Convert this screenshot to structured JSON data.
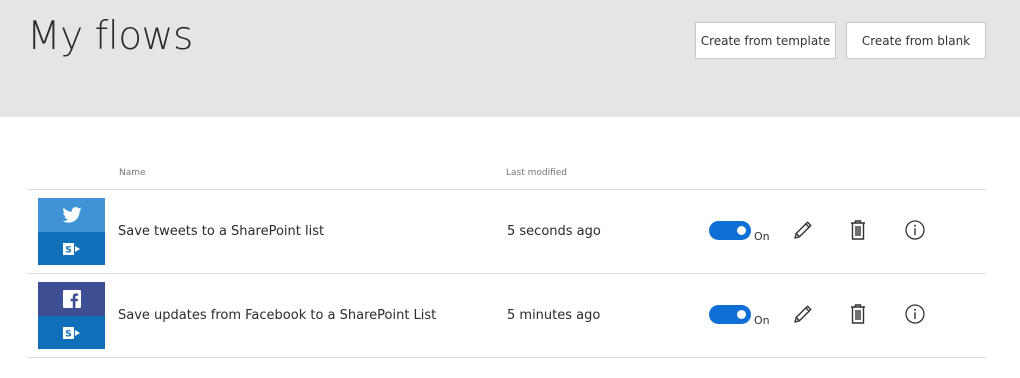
{
  "header": {
    "title": "My flows",
    "create_template_label": "Create from template",
    "create_blank_label": "Create from blank"
  },
  "table": {
    "columns": {
      "name": "Name",
      "modified": "Last modified"
    },
    "rows": [
      {
        "name": "Save tweets to a SharePoint list",
        "modified": "5 seconds ago",
        "toggle_label": "On",
        "toggle_on": true,
        "source_icon": "twitter-icon",
        "target_icon": "sharepoint-icon"
      },
      {
        "name": "Save updates from Facebook to a SharePoint List",
        "modified": "5 minutes ago",
        "toggle_label": "On",
        "toggle_on": true,
        "source_icon": "facebook-icon",
        "target_icon": "sharepoint-icon"
      }
    ]
  },
  "colors": {
    "header_bg": "#e5e5e5",
    "toggle_on": "#0f6fd6",
    "twitter_tile": "#3f93d6",
    "facebook_tile": "#3d4f92",
    "sharepoint_tile": "#0f6fb8"
  }
}
